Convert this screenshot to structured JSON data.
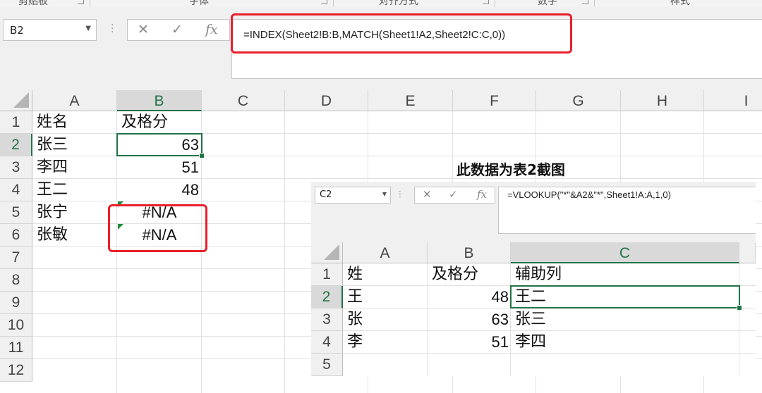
{
  "ribbon": {
    "groups": [
      "剪贴板",
      "字体",
      "对齐方式",
      "数字",
      "样式"
    ]
  },
  "formula_bar": {
    "name_box": "B2",
    "cancel_icon": "✕",
    "enter_icon": "✓",
    "fx_label": "fx",
    "formula": "=INDEX(Sheet2!B:B,MATCH(Sheet1!A2,Sheet2!C:C,0))"
  },
  "sheet": {
    "columns": [
      "A",
      "B",
      "C",
      "D",
      "E",
      "F",
      "G",
      "H",
      "I"
    ],
    "rows": [
      "1",
      "2",
      "3",
      "4",
      "5",
      "6",
      "7",
      "8",
      "9",
      "10",
      "11",
      "12"
    ],
    "header_a": "姓名",
    "header_b": "及格分",
    "data": [
      {
        "name": "张三",
        "score": "63"
      },
      {
        "name": "李四",
        "score": "51"
      },
      {
        "name": "王二",
        "score": "48"
      },
      {
        "name": "张宁",
        "score": "#N/A"
      },
      {
        "name": "张敏",
        "score": "#N/A"
      }
    ],
    "active_cell": "B2"
  },
  "annotation": {
    "text": "此数据为表2截图"
  },
  "sheet2_screenshot": {
    "name_box": "C2",
    "fx_label": "fx",
    "formula": "=VLOOKUP(\"*\"&A2&\"*\",Sheet1!A:A,1,0)",
    "columns": [
      "A",
      "B",
      "C"
    ],
    "rows": [
      "1",
      "2",
      "3",
      "4",
      "5"
    ],
    "header_a": "姓",
    "header_b": "及格分",
    "header_c": "辅助列",
    "data": [
      {
        "surname": "王",
        "score": "48",
        "helper": "王二"
      },
      {
        "surname": "张",
        "score": "63",
        "helper": "张三"
      },
      {
        "surname": "李",
        "score": "51",
        "helper": "李四"
      }
    ]
  },
  "colors": {
    "accent_green": "#217346",
    "highlight_red": "#e8202a",
    "error_flag": "#1e8b3c"
  }
}
